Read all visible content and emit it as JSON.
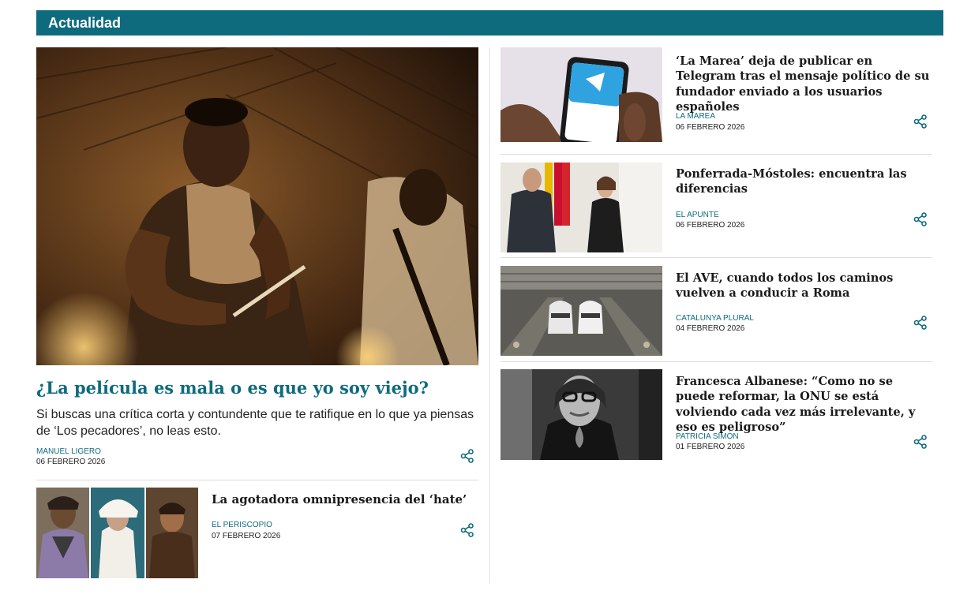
{
  "section": {
    "title": "Actualidad"
  },
  "colors": {
    "accent": "#0e6b7e",
    "divider": "#dcdcdc"
  },
  "hero": {
    "title": "¿La película es mala o es que yo soy viejo?",
    "lead": "Si buscas una crítica corta y contundente que te ratifique en lo que ya piensas de ‘Los pecadores’, no leas esto.",
    "author": "MANUEL LIGERO",
    "date": "06 FEBRERO 2026",
    "share_icon": "share-icon"
  },
  "secondary": {
    "title": "La agotadora omnipresencia del ‘hate’",
    "author": "EL PERISCOPIO",
    "date": "07 FEBRERO 2026",
    "share_icon": "share-icon"
  },
  "side_articles": [
    {
      "title": "‘La Marea’ deja de publicar en Telegram tras el mensaje político de su fundador enviado a los usuarios españoles",
      "author": "LA MAREA",
      "date": "06 FEBRERO 2026",
      "phone_label": "Telegram"
    },
    {
      "title": "Ponferrada-Móstoles: encuentra las diferencias",
      "author": "EL APUNTE",
      "date": "06 FEBRERO 2026"
    },
    {
      "title": "El AVE, cuando todos los caminos vuelven a conducir a Roma",
      "author": "CATALUNYA PLURAL",
      "date": "04 FEBRERO 2026"
    },
    {
      "title": "Francesca Albanese: “Como no se puede reformar, la ONU se está volviendo cada vez más irrelevante, y eso es peligroso”",
      "author": "PATRICIA SIMÓN",
      "date": "01 FEBRERO 2026"
    }
  ]
}
